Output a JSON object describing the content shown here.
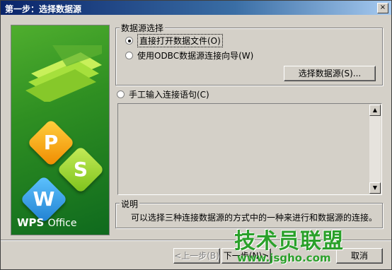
{
  "window": {
    "title": "第一步：选择数据源",
    "close_glyph": "×"
  },
  "art": {
    "letters": [
      "P",
      "S",
      "W"
    ],
    "brand": "WPS",
    "brand_suffix": "Office"
  },
  "source_group": {
    "legend": "数据源选择",
    "option_open_file": "直接打开数据文件(O)",
    "option_odbc": "使用ODBC数据源连接向导(W)",
    "select_button": "选择数据源(S)...",
    "selected": "open_file"
  },
  "manual": {
    "label": "手工输入连接语句(C)",
    "value": ""
  },
  "scrollbar": {
    "up_glyph": "▲",
    "down_glyph": "▼"
  },
  "help": {
    "legend": "说明",
    "text": "可以选择三种连接数据源的方式中的一种来进行和数据源的连接。"
  },
  "footer": {
    "back_label": "<上一步(B)",
    "next_label": "下一步(N)>",
    "cancel_label": "取消"
  },
  "watermark": {
    "text": "技术员联盟",
    "url": "www.jsgho.com"
  }
}
